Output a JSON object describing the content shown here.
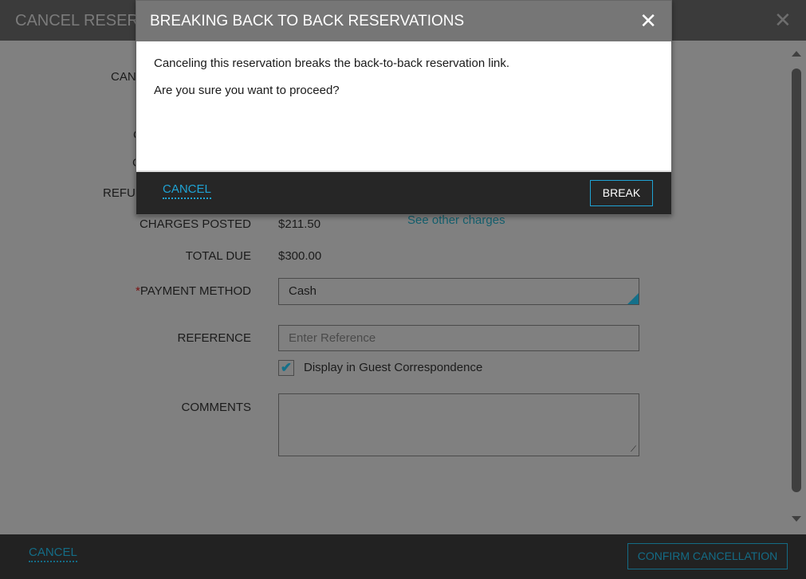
{
  "dialog": {
    "title": "CANCEL RESERVATION",
    "close_icon": "close-icon"
  },
  "form": {
    "hidden_label_fragments": [
      "CAN",
      "C",
      "C",
      "REFU"
    ],
    "charges_posted_label": "CHARGES POSTED",
    "charges_posted_value": "$211.50",
    "see_other_charges": "See other charges",
    "total_due_label": "TOTAL DUE",
    "total_due_value": "$300.00",
    "payment_required_mark": "*",
    "payment_method_label": "PAYMENT METHOD",
    "payment_method_value": "Cash",
    "reference_label": "REFERENCE",
    "reference_placeholder": "Enter Reference",
    "display_checkbox_label": "Display in Guest Correspondence",
    "display_checked": true,
    "comments_label": "COMMENTS",
    "comments_value": ""
  },
  "footer": {
    "cancel": "CANCEL",
    "confirm": "CONFIRM CANCELLATION"
  },
  "modal": {
    "title": "BREAKING BACK TO BACK RESERVATIONS",
    "message1": "Canceling this reservation breaks the back-to-back reservation link.",
    "message2": "Are you sure you want to proceed?",
    "cancel": "CANCEL",
    "break": "BREAK"
  },
  "colors": {
    "accent": "#1fa3d4",
    "overlay": "#808080"
  }
}
